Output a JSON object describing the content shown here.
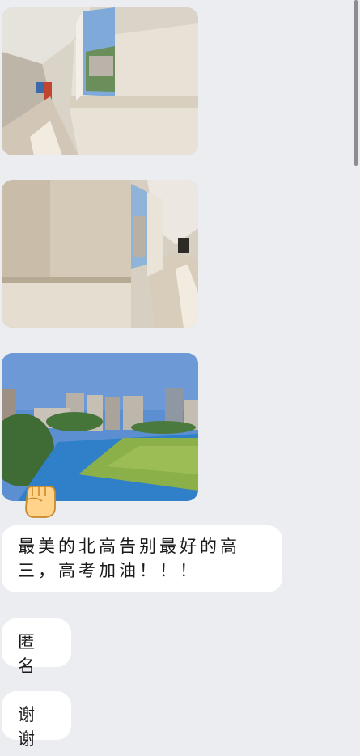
{
  "messages": [
    {
      "type": "image",
      "name": "photo-corridor-1"
    },
    {
      "type": "image",
      "name": "photo-corridor-2"
    },
    {
      "type": "image",
      "name": "photo-campus-field"
    },
    {
      "type": "sticker",
      "icon": "raised-fist-icon"
    },
    {
      "type": "text",
      "text": "最美的北高告别最好的高三，高考加油！！！"
    },
    {
      "type": "text",
      "text": "匿名"
    },
    {
      "type": "text",
      "text": "谢谢"
    }
  ],
  "colors": {
    "background": "#ecedf1",
    "bubble": "#ffffff",
    "text": "#1a1a1a"
  }
}
